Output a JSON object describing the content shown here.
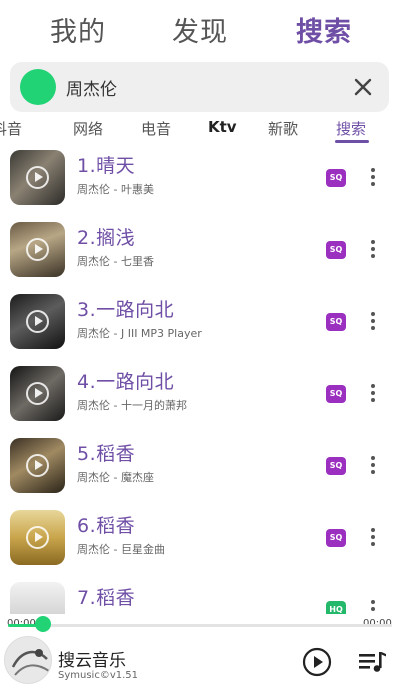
{
  "top_tabs": [
    {
      "label": "我的"
    },
    {
      "label": "发现"
    },
    {
      "label": "搜索"
    }
  ],
  "search": {
    "query": "周杰伦"
  },
  "sub_tabs": [
    {
      "label": "抖音"
    },
    {
      "label": "网络"
    },
    {
      "label": "电音"
    },
    {
      "label": "Ktv"
    },
    {
      "label": "新歌"
    },
    {
      "label": "搜索"
    }
  ],
  "songs": [
    {
      "title": "1.晴天",
      "artist": "周杰伦 - 叶惠美",
      "quality": "SQ"
    },
    {
      "title": "2.搁浅",
      "artist": "周杰伦 - 七里香",
      "quality": "SQ"
    },
    {
      "title": "3.一路向北",
      "artist": "周杰伦 - J III MP3 Player",
      "quality": "SQ"
    },
    {
      "title": "4.一路向北",
      "artist": "周杰伦 - 十一月的萧邦",
      "quality": "SQ"
    },
    {
      "title": "5.稻香",
      "artist": "周杰伦 - 魔杰座",
      "quality": "SQ"
    },
    {
      "title": "6.稻香",
      "artist": "周杰伦 - 巨星金曲",
      "quality": "SQ"
    },
    {
      "title": "7.稻香",
      "artist": "",
      "quality": "HQ"
    }
  ],
  "player": {
    "current_time": "00:00",
    "total_time": "00:00",
    "progress": 0.09,
    "title": "搜云音乐",
    "subtitle": "Symusic©v1.51"
  },
  "colors": {
    "accent": "#6f4fa6",
    "green": "#21d375",
    "sq_badge": "#9a2fc0",
    "hq_badge": "#23b86a"
  }
}
